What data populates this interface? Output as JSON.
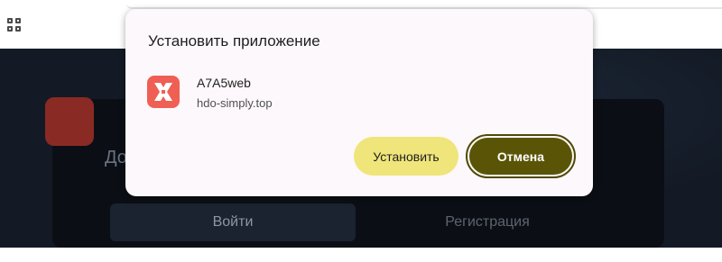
{
  "dialog": {
    "title": "Установить приложение",
    "app_name": "A7A5web",
    "app_domain": "hdo-simply.top",
    "app_icon": "app-logo-icon",
    "install_label": "Установить",
    "cancel_label": "Отмена"
  },
  "page": {
    "heading": "До",
    "login_tab": "Войти",
    "register_tab": "Регистрация"
  },
  "browser": {
    "apps_icon": "apps-grid-icon"
  },
  "colors": {
    "install_button": "#efe57a",
    "cancel_button": "#5a5506",
    "app_icon": "#ef5f54",
    "page_background": "#131a25"
  }
}
